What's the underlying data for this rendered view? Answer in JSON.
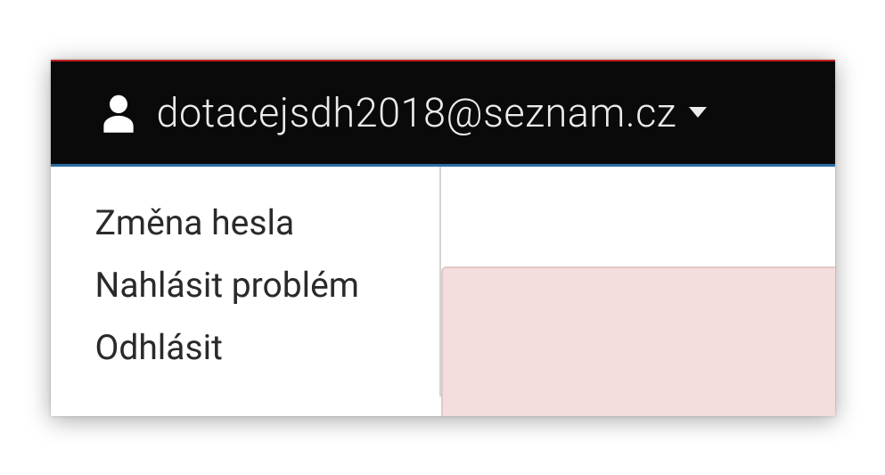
{
  "header": {
    "user_email": "dotacejsdh2018@seznam.cz"
  },
  "menu": {
    "items": [
      {
        "label": "Změna hesla"
      },
      {
        "label": "Nahlásit problém"
      },
      {
        "label": "Odhlásit"
      }
    ]
  }
}
